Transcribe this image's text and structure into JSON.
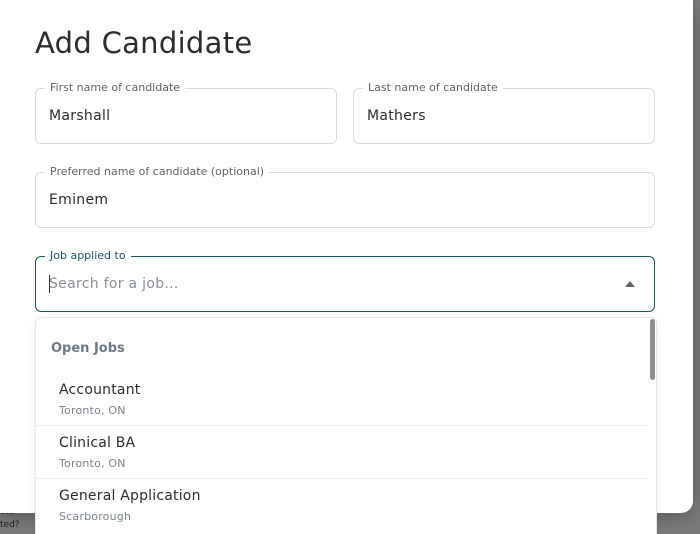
{
  "background": {
    "snippet_1": "ate",
    "snippet_2": "ted?"
  },
  "modal": {
    "title": "Add Candidate",
    "first_name": {
      "label": "First name of candidate",
      "value": "Marshall"
    },
    "last_name": {
      "label": "Last name of candidate",
      "value": "Mathers"
    },
    "preferred_name": {
      "label": "Preferred name of candidate (optional)",
      "value": "Eminem"
    },
    "job": {
      "label": "Job applied to",
      "value": "",
      "placeholder": "Search for a job..."
    }
  },
  "dropdown": {
    "group_label": "Open Jobs",
    "options": [
      {
        "name": "Accountant",
        "location": "Toronto, ON"
      },
      {
        "name": "Clinical BA",
        "location": "Toronto, ON"
      },
      {
        "name": "General Application",
        "location": "Scarborough"
      }
    ]
  },
  "colors": {
    "focus_border": "#1a5561",
    "backdrop": "#7a7a7a",
    "group_header": "#6d7a86"
  }
}
